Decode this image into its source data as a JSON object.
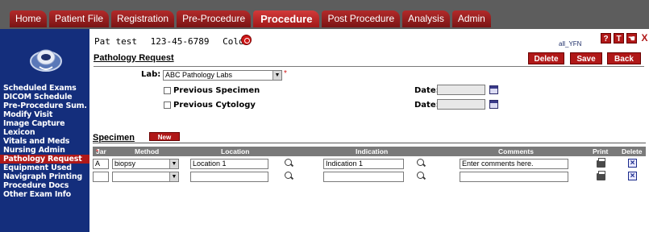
{
  "nav": {
    "tabs": [
      "Home",
      "Patient File",
      "Registration",
      "Pre-Procedure",
      "Procedure",
      "Post Procedure",
      "Analysis",
      "Admin"
    ],
    "active_tab": "Procedure"
  },
  "sidebar": {
    "items": [
      "Scheduled Exams",
      "DICOM Schedule",
      "Pre-Procedure Sum.",
      "Modify Visit",
      "Image Capture",
      "Lexicon",
      "Vitals and Meds",
      "Nursing Admin",
      "Pathology Request",
      "Equipment Used",
      "Navigraph Printing",
      "Procedure Docs",
      "Other Exam Info"
    ],
    "active_item": "Pathology Request"
  },
  "patient": {
    "name": "Pat test",
    "id": "123-45-6789",
    "exam": "Colon"
  },
  "user": {
    "label": "all_YFN"
  },
  "toolbar": {
    "help_label": "?",
    "t_label": "T",
    "pin_label": "☚",
    "close_label": "X"
  },
  "page": {
    "title": "Pathology Request",
    "delete_label": "Delete",
    "save_label": "Save",
    "back_label": "Back"
  },
  "form": {
    "lab_label": "Lab:",
    "lab_value": "ABC Pathology Labs",
    "required_mark": "*",
    "prev_specimen_label": "Previous Specimen",
    "prev_cytology_label": "Previous Cytology",
    "date_label": "Date:"
  },
  "specimen": {
    "title": "Specimen",
    "new_label": "New",
    "columns": [
      "Jar",
      "Method",
      "Location",
      "Indication",
      "Comments",
      "Print",
      "Delete"
    ],
    "jar_required_mark": "*",
    "rows": [
      {
        "jar": "A",
        "method": "biopsy",
        "location": "Location 1",
        "indication": "Indication 1",
        "comments": "Enter comments here."
      },
      {
        "jar": "",
        "method": "",
        "location": "",
        "indication": "",
        "comments": ""
      }
    ]
  },
  "colors": {
    "accent_red": "#b01818",
    "sidebar_blue": "#142e7c",
    "topbar_gray": "#5d5d5d"
  }
}
